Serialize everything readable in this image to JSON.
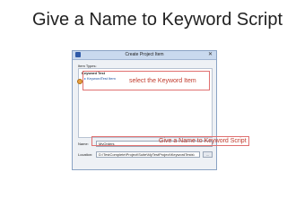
{
  "slide": {
    "title": "Give a Name to Keyword Script"
  },
  "dialog": {
    "title": "Create Project Item",
    "close_glyph": "✕",
    "item_types_label": "Item Types:",
    "group_label": "Keyword Test",
    "tree_item_label": "KeywordTest Item",
    "name_label": "Name:",
    "name_value": "MyOrders",
    "location_label": "Location:",
    "location_value": "D:\\TestComplete\\Project\\Suite\\MyTestProject\\KeywordTests\\",
    "browse_label": "..."
  },
  "callouts": {
    "select_keyword_item": "select the Keyword Item",
    "give_name": "Give a Name to Keyword Script"
  },
  "colors": {
    "callout": "#c0392b",
    "callout_border": "#e07070",
    "title_bar": "#c9d9ee",
    "link": "#1a4fa0"
  },
  "icons": {
    "app": "app-icon",
    "close": "close-icon",
    "tree_bullet": "keyword-item-icon",
    "pin": "pin-icon"
  }
}
